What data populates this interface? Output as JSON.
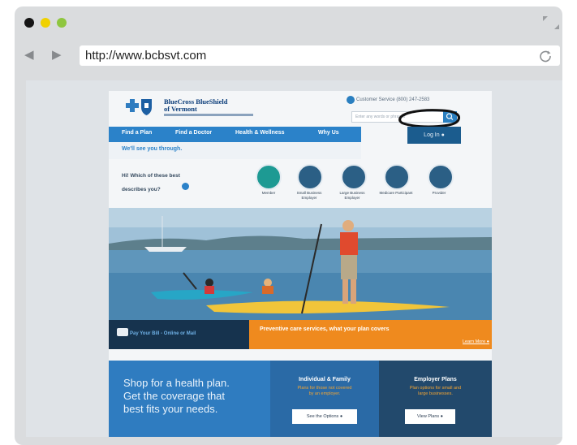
{
  "browser": {
    "url": "http://www.bcbsvt.com",
    "colors": {
      "close": "#151515",
      "minimize": "#f0d100",
      "maximize": "#8ec63f"
    }
  },
  "site": {
    "brand_line1": "BlueCross BlueShield",
    "brand_line2": "of Vermont",
    "customer_service": "Customer Service (800) 247-2583",
    "search_placeholder": "Enter any words or phrases",
    "nav": [
      "Find a Plan",
      "Find a Doctor",
      "Health & Wellness",
      "Why Us"
    ],
    "login": "Log In",
    "tagline": "We'll see you through.",
    "question_line1": "Hi! Which of these best",
    "question_line2": "describes you?",
    "audiences": [
      {
        "label": "Member"
      },
      {
        "label": "Small Business Employer"
      },
      {
        "label": "Large Business Employer"
      },
      {
        "label": "Medicare Participant"
      },
      {
        "label": "Provider"
      }
    ],
    "pay_bill": "Pay Your Bill - Online or Mail",
    "promo": "Preventive care services, what your plan covers",
    "learn_more": "Learn More",
    "shop_line1": "Shop for a health plan.",
    "shop_line2": "Get the coverage that",
    "shop_line3": "best fits your needs.",
    "individual_title": "Individual & Family",
    "individual_sub1": "Plans for those not covered",
    "individual_sub2": "by an employer.",
    "individual_btn": "See the Options",
    "employer_title": "Employer Plans",
    "employer_sub1": "Plan options for small and",
    "employer_sub2": "large businesses.",
    "employer_btn": "View Plans"
  }
}
